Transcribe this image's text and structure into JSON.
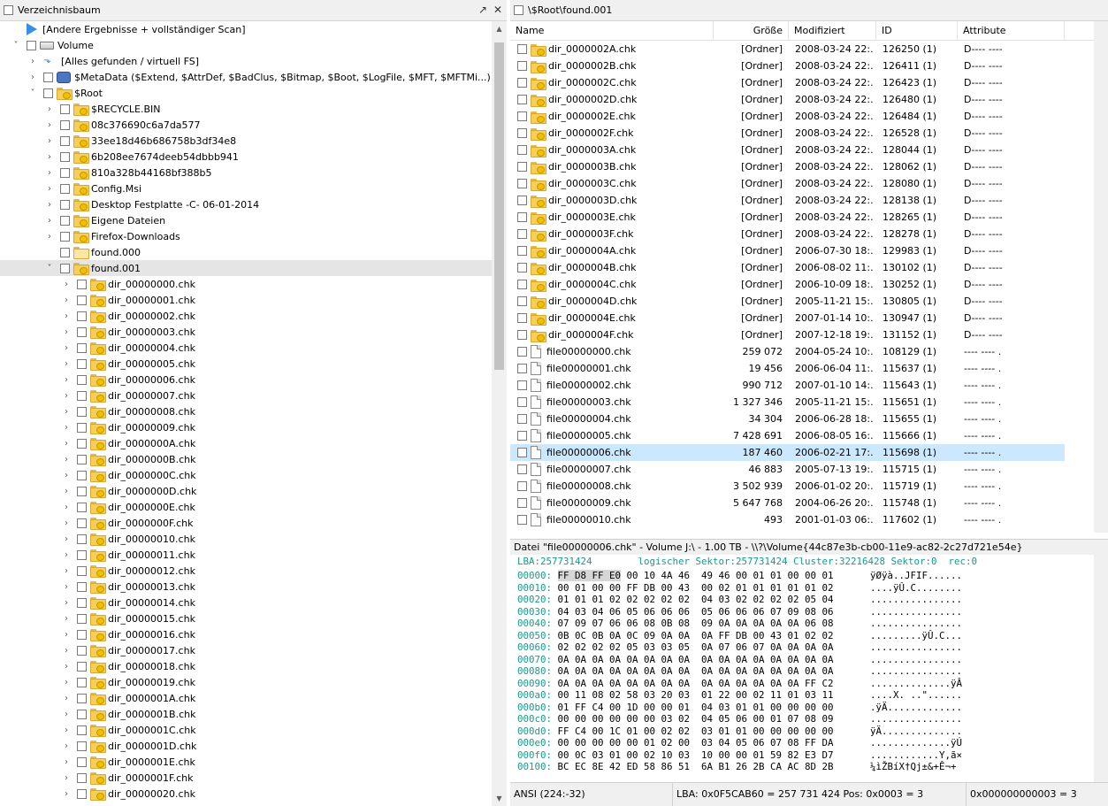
{
  "left_pane": {
    "title": "Verzeichnisbaum",
    "pin_icon": "pin-icon",
    "close_icon": "close-icon"
  },
  "tree": [
    {
      "label": "[Andere Ergebnisse + vollständiger Scan]",
      "level": 0,
      "arrow": "",
      "checkbox": false,
      "icon": "play"
    },
    {
      "label": "Volume",
      "level": 0,
      "arrow": "down",
      "checkbox": true,
      "icon": "drive"
    },
    {
      "label": "[Alles gefunden / virtuell FS]",
      "level": 1,
      "arrow": "right",
      "checkbox": false,
      "icon": "vfs"
    },
    {
      "label": "$MetaData ($Extend, $AttrDef, $BadClus, $Bitmap, $Boot, $LogFile, $MFT, $MFTMi...)",
      "level": 1,
      "arrow": "right",
      "checkbox": true,
      "icon": "meta"
    },
    {
      "label": "$Root",
      "level": 1,
      "arrow": "down",
      "checkbox": true,
      "icon": "folder"
    },
    {
      "label": "$RECYCLE.BIN",
      "level": 2,
      "arrow": "right",
      "checkbox": true,
      "icon": "folder"
    },
    {
      "label": "08c376690c6a7da577",
      "level": 2,
      "arrow": "right",
      "checkbox": true,
      "icon": "folder"
    },
    {
      "label": "33ee18d46b686758b3df34e8",
      "level": 2,
      "arrow": "right",
      "checkbox": true,
      "icon": "folder"
    },
    {
      "label": "6b208ee7674deeb54dbbb941",
      "level": 2,
      "arrow": "right",
      "checkbox": true,
      "icon": "folder"
    },
    {
      "label": "810a328b44168bf388b5",
      "level": 2,
      "arrow": "right",
      "checkbox": true,
      "icon": "folder"
    },
    {
      "label": "Config.Msi",
      "level": 2,
      "arrow": "right",
      "checkbox": true,
      "icon": "folder"
    },
    {
      "label": "Desktop Festplatte -C- 06-01-2014",
      "level": 2,
      "arrow": "right",
      "checkbox": true,
      "icon": "folder"
    },
    {
      "label": "Eigene Dateien",
      "level": 2,
      "arrow": "right",
      "checkbox": true,
      "icon": "folder"
    },
    {
      "label": "Firefox-Downloads",
      "level": 2,
      "arrow": "right",
      "checkbox": true,
      "icon": "folder"
    },
    {
      "label": "found.000",
      "level": 2,
      "arrow": "",
      "checkbox": true,
      "icon": "folder-light"
    },
    {
      "label": "found.001",
      "level": 2,
      "arrow": "down",
      "checkbox": true,
      "icon": "folder",
      "selected": true
    },
    {
      "label": "dir_00000000.chk",
      "level": 3,
      "arrow": "right",
      "checkbox": true,
      "icon": "folder"
    },
    {
      "label": "dir_00000001.chk",
      "level": 3,
      "arrow": "right",
      "checkbox": true,
      "icon": "folder"
    },
    {
      "label": "dir_00000002.chk",
      "level": 3,
      "arrow": "right",
      "checkbox": true,
      "icon": "folder"
    },
    {
      "label": "dir_00000003.chk",
      "level": 3,
      "arrow": "right",
      "checkbox": true,
      "icon": "folder"
    },
    {
      "label": "dir_00000004.chk",
      "level": 3,
      "arrow": "right",
      "checkbox": true,
      "icon": "folder"
    },
    {
      "label": "dir_00000005.chk",
      "level": 3,
      "arrow": "right",
      "checkbox": true,
      "icon": "folder"
    },
    {
      "label": "dir_00000006.chk",
      "level": 3,
      "arrow": "right",
      "checkbox": true,
      "icon": "folder"
    },
    {
      "label": "dir_00000007.chk",
      "level": 3,
      "arrow": "right",
      "checkbox": true,
      "icon": "folder"
    },
    {
      "label": "dir_00000008.chk",
      "level": 3,
      "arrow": "right",
      "checkbox": true,
      "icon": "folder"
    },
    {
      "label": "dir_00000009.chk",
      "level": 3,
      "arrow": "right",
      "checkbox": true,
      "icon": "folder"
    },
    {
      "label": "dir_0000000A.chk",
      "level": 3,
      "arrow": "right",
      "checkbox": true,
      "icon": "folder"
    },
    {
      "label": "dir_0000000B.chk",
      "level": 3,
      "arrow": "right",
      "checkbox": true,
      "icon": "folder"
    },
    {
      "label": "dir_0000000C.chk",
      "level": 3,
      "arrow": "right",
      "checkbox": true,
      "icon": "folder"
    },
    {
      "label": "dir_0000000D.chk",
      "level": 3,
      "arrow": "right",
      "checkbox": true,
      "icon": "folder"
    },
    {
      "label": "dir_0000000E.chk",
      "level": 3,
      "arrow": "right",
      "checkbox": true,
      "icon": "folder"
    },
    {
      "label": "dir_0000000F.chk",
      "level": 3,
      "arrow": "right",
      "checkbox": true,
      "icon": "folder"
    },
    {
      "label": "dir_00000010.chk",
      "level": 3,
      "arrow": "right",
      "checkbox": true,
      "icon": "folder"
    },
    {
      "label": "dir_00000011.chk",
      "level": 3,
      "arrow": "right",
      "checkbox": true,
      "icon": "folder"
    },
    {
      "label": "dir_00000012.chk",
      "level": 3,
      "arrow": "right",
      "checkbox": true,
      "icon": "folder"
    },
    {
      "label": "dir_00000013.chk",
      "level": 3,
      "arrow": "right",
      "checkbox": true,
      "icon": "folder"
    },
    {
      "label": "dir_00000014.chk",
      "level": 3,
      "arrow": "right",
      "checkbox": true,
      "icon": "folder"
    },
    {
      "label": "dir_00000015.chk",
      "level": 3,
      "arrow": "right",
      "checkbox": true,
      "icon": "folder"
    },
    {
      "label": "dir_00000016.chk",
      "level": 3,
      "arrow": "right",
      "checkbox": true,
      "icon": "folder"
    },
    {
      "label": "dir_00000017.chk",
      "level": 3,
      "arrow": "right",
      "checkbox": true,
      "icon": "folder"
    },
    {
      "label": "dir_00000018.chk",
      "level": 3,
      "arrow": "right",
      "checkbox": true,
      "icon": "folder"
    },
    {
      "label": "dir_00000019.chk",
      "level": 3,
      "arrow": "right",
      "checkbox": true,
      "icon": "folder"
    },
    {
      "label": "dir_0000001A.chk",
      "level": 3,
      "arrow": "right",
      "checkbox": true,
      "icon": "folder"
    },
    {
      "label": "dir_0000001B.chk",
      "level": 3,
      "arrow": "right",
      "checkbox": true,
      "icon": "folder"
    },
    {
      "label": "dir_0000001C.chk",
      "level": 3,
      "arrow": "right",
      "checkbox": true,
      "icon": "folder"
    },
    {
      "label": "dir_0000001D.chk",
      "level": 3,
      "arrow": "right",
      "checkbox": true,
      "icon": "folder"
    },
    {
      "label": "dir_0000001E.chk",
      "level": 3,
      "arrow": "right",
      "checkbox": true,
      "icon": "folder"
    },
    {
      "label": "dir_0000001F.chk",
      "level": 3,
      "arrow": "right",
      "checkbox": true,
      "icon": "folder"
    },
    {
      "label": "dir_00000020.chk",
      "level": 3,
      "arrow": "right",
      "checkbox": true,
      "icon": "folder"
    }
  ],
  "right_pane": {
    "path": "\\$Root\\found.001",
    "columns": [
      "Name",
      "Größe",
      "Modifiziert",
      "ID",
      "Attribute"
    ]
  },
  "files": [
    {
      "name": "dir_0000002A.chk",
      "size": "[Ordner]",
      "mod": "2008-03-24 22:...",
      "id": "126250 (1)",
      "attr": "D---- ----",
      "type": "folder"
    },
    {
      "name": "dir_0000002B.chk",
      "size": "[Ordner]",
      "mod": "2008-03-24 22:...",
      "id": "126411 (1)",
      "attr": "D---- ----",
      "type": "folder"
    },
    {
      "name": "dir_0000002C.chk",
      "size": "[Ordner]",
      "mod": "2008-03-24 22:...",
      "id": "126423 (1)",
      "attr": "D---- ----",
      "type": "folder"
    },
    {
      "name": "dir_0000002D.chk",
      "size": "[Ordner]",
      "mod": "2008-03-24 22:...",
      "id": "126480 (1)",
      "attr": "D---- ----",
      "type": "folder"
    },
    {
      "name": "dir_0000002E.chk",
      "size": "[Ordner]",
      "mod": "2008-03-24 22:...",
      "id": "126484 (1)",
      "attr": "D---- ----",
      "type": "folder"
    },
    {
      "name": "dir_0000002F.chk",
      "size": "[Ordner]",
      "mod": "2008-03-24 22:...",
      "id": "126528 (1)",
      "attr": "D---- ----",
      "type": "folder"
    },
    {
      "name": "dir_0000003A.chk",
      "size": "[Ordner]",
      "mod": "2008-03-24 22:...",
      "id": "128044 (1)",
      "attr": "D---- ----",
      "type": "folder"
    },
    {
      "name": "dir_0000003B.chk",
      "size": "[Ordner]",
      "mod": "2008-03-24 22:...",
      "id": "128062 (1)",
      "attr": "D---- ----",
      "type": "folder"
    },
    {
      "name": "dir_0000003C.chk",
      "size": "[Ordner]",
      "mod": "2008-03-24 22:...",
      "id": "128080 (1)",
      "attr": "D---- ----",
      "type": "folder"
    },
    {
      "name": "dir_0000003D.chk",
      "size": "[Ordner]",
      "mod": "2008-03-24 22:...",
      "id": "128138 (1)",
      "attr": "D---- ----",
      "type": "folder"
    },
    {
      "name": "dir_0000003E.chk",
      "size": "[Ordner]",
      "mod": "2008-03-24 22:...",
      "id": "128265 (1)",
      "attr": "D---- ----",
      "type": "folder"
    },
    {
      "name": "dir_0000003F.chk",
      "size": "[Ordner]",
      "mod": "2008-03-24 22:...",
      "id": "128278 (1)",
      "attr": "D---- ----",
      "type": "folder"
    },
    {
      "name": "dir_0000004A.chk",
      "size": "[Ordner]",
      "mod": "2006-07-30 18:...",
      "id": "129983 (1)",
      "attr": "D---- ----",
      "type": "folder"
    },
    {
      "name": "dir_0000004B.chk",
      "size": "[Ordner]",
      "mod": "2006-08-02 11:...",
      "id": "130102 (1)",
      "attr": "D---- ----",
      "type": "folder"
    },
    {
      "name": "dir_0000004C.chk",
      "size": "[Ordner]",
      "mod": "2006-10-09 18:...",
      "id": "130252 (1)",
      "attr": "D---- ----",
      "type": "folder"
    },
    {
      "name": "dir_0000004D.chk",
      "size": "[Ordner]",
      "mod": "2005-11-21 15:...",
      "id": "130805 (1)",
      "attr": "D---- ----",
      "type": "folder"
    },
    {
      "name": "dir_0000004E.chk",
      "size": "[Ordner]",
      "mod": "2007-01-14 10:...",
      "id": "130947 (1)",
      "attr": "D---- ----",
      "type": "folder"
    },
    {
      "name": "dir_0000004F.chk",
      "size": "[Ordner]",
      "mod": "2007-12-18 19:...",
      "id": "131152 (1)",
      "attr": "D---- ----",
      "type": "folder"
    },
    {
      "name": "file00000000.chk",
      "size": "259 072",
      "mod": "2004-05-24 10:...",
      "id": "108129 (1)",
      "attr": "---- ----  .",
      "type": "file"
    },
    {
      "name": "file00000001.chk",
      "size": "19 456",
      "mod": "2006-06-04 11:...",
      "id": "115637 (1)",
      "attr": "---- ----  .",
      "type": "file"
    },
    {
      "name": "file00000002.chk",
      "size": "990 712",
      "mod": "2007-01-10 14:...",
      "id": "115643 (1)",
      "attr": "---- ----  .",
      "type": "file"
    },
    {
      "name": "file00000003.chk",
      "size": "1 327 346",
      "mod": "2005-11-21 15:...",
      "id": "115651 (1)",
      "attr": "---- ----  .",
      "type": "file"
    },
    {
      "name": "file00000004.chk",
      "size": "34 304",
      "mod": "2006-06-28 18:...",
      "id": "115655 (1)",
      "attr": "---- ----  .",
      "type": "file"
    },
    {
      "name": "file00000005.chk",
      "size": "7 428 691",
      "mod": "2006-08-05 16:...",
      "id": "115666 (1)",
      "attr": "---- ----  .",
      "type": "file"
    },
    {
      "name": "file00000006.chk",
      "size": "187 460",
      "mod": "2006-02-21 17:...",
      "id": "115698 (1)",
      "attr": "---- ----  .",
      "type": "file",
      "selected": true
    },
    {
      "name": "file00000007.chk",
      "size": "46 883",
      "mod": "2005-07-13 19:...",
      "id": "115715 (1)",
      "attr": "---- ----  .",
      "type": "file"
    },
    {
      "name": "file00000008.chk",
      "size": "3 502 939",
      "mod": "2006-01-02 20:...",
      "id": "115719 (1)",
      "attr": "---- ----  .",
      "type": "file"
    },
    {
      "name": "file00000009.chk",
      "size": "5 647 768",
      "mod": "2004-06-26 20:...",
      "id": "115748 (1)",
      "attr": "---- ----  .",
      "type": "file"
    },
    {
      "name": "file00000010.chk",
      "size": "493",
      "mod": "2001-01-03 06:...",
      "id": "117602 (1)",
      "attr": "---- ----  .",
      "type": "file"
    }
  ],
  "hex": {
    "info": "Datei \"file00000006.chk\" - Volume J:\\ - 1.00 TB - \\\\?\\Volume{44c87e3b-cb00-11e9-ac82-2c27d721e54e}",
    "status": "LBA:257731424        logischer Sektor:257731424 Cluster:32216428 Sektor:0  rec:0",
    "lines": [
      {
        "off": "00000:",
        "hex": "FF D8 FF E0 00 10 4A 46  49 46 00 01 01 00 00 01",
        "ascii": "ÿØÿà..JFIF......"
      },
      {
        "off": "00010:",
        "hex": "00 01 00 00 FF DB 00 43  00 02 01 01 01 01 01 02",
        "ascii": "....ÿÛ.C........"
      },
      {
        "off": "00020:",
        "hex": "01 01 01 02 02 02 02 02  04 03 02 02 02 02 05 04",
        "ascii": "................"
      },
      {
        "off": "00030:",
        "hex": "04 03 04 06 05 06 06 06  05 06 06 06 07 09 08 06",
        "ascii": "................"
      },
      {
        "off": "00040:",
        "hex": "07 09 07 06 06 08 0B 08  09 0A 0A 0A 0A 0A 06 08",
        "ascii": "................"
      },
      {
        "off": "00050:",
        "hex": "0B 0C 0B 0A 0C 09 0A 0A  0A FF DB 00 43 01 02 02",
        "ascii": ".........ÿÛ.C..."
      },
      {
        "off": "00060:",
        "hex": "02 02 02 02 05 03 03 05  0A 07 06 07 0A 0A 0A 0A",
        "ascii": "................"
      },
      {
        "off": "00070:",
        "hex": "0A 0A 0A 0A 0A 0A 0A 0A  0A 0A 0A 0A 0A 0A 0A 0A",
        "ascii": "................"
      },
      {
        "off": "00080:",
        "hex": "0A 0A 0A 0A 0A 0A 0A 0A  0A 0A 0A 0A 0A 0A 0A 0A",
        "ascii": "................"
      },
      {
        "off": "00090:",
        "hex": "0A 0A 0A 0A 0A 0A 0A 0A  0A 0A 0A 0A 0A 0A FF C2",
        "ascii": "..............ÿÂ"
      },
      {
        "off": "000a0:",
        "hex": "00 11 08 02 58 03 20 03  01 22 00 02 11 01 03 11",
        "ascii": "....X. ..\"......"
      },
      {
        "off": "000b0:",
        "hex": "01 FF C4 00 1D 00 00 01  04 03 01 01 00 00 00 00",
        "ascii": ".ÿÄ............."
      },
      {
        "off": "000c0:",
        "hex": "00 00 00 00 00 00 03 02  04 05 06 00 01 07 08 09",
        "ascii": "................"
      },
      {
        "off": "000d0:",
        "hex": "FF C4 00 1C 01 00 02 02  03 01 01 00 00 00 00 00",
        "ascii": "ÿÄ.............."
      },
      {
        "off": "000e0:",
        "hex": "00 00 00 00 00 01 02 00  03 04 05 06 07 08 FF DA",
        "ascii": "..............ÿÚ"
      },
      {
        "off": "000f0:",
        "hex": "00 0C 03 01 00 02 10 03  10 00 00 01 59 82 E3 D7",
        "ascii": "............Y‚ã×"
      },
      {
        "off": "00100:",
        "hex": "BC EC 8E 42 ED 58 86 51  6A B1 26 2B CA AC 8D 2B",
        "ascii": "¼ìŽBíX†Qj±&+Ê¬+"
      }
    ]
  },
  "statusbar": {
    "encoding": "ANSI (224:-32)",
    "lba": "LBA: 0x0F5CAB60 = 257 731 424  Pos: 0x0003 = 3",
    "offset": "0x000000000003 = 3"
  }
}
